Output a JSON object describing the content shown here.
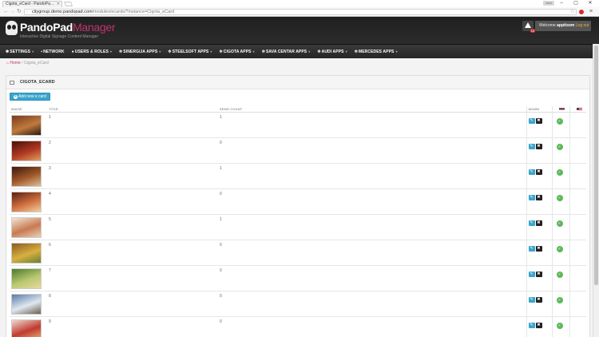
{
  "browser": {
    "tab_title": "Cigota_eCard - PandoPa…",
    "url_host": "citygroup.demo.pandopad.com",
    "url_path": "/modules/ecards/?instance=Cigota_eCard",
    "user_button": "User"
  },
  "header": {
    "brand_main": "PandoPad",
    "brand_accent": "Manager",
    "tagline": "Interactive Digital Signage Content Manager",
    "notification_count": "10",
    "welcome_prefix": "Welcome ",
    "username": "appitsom",
    "logout": " Log out"
  },
  "nav": [
    {
      "icon": "gear-icon",
      "label": "SETTINGS",
      "dropdown": true
    },
    {
      "icon": "network-icon",
      "label": "NETWORK",
      "dropdown": false
    },
    {
      "icon": "users-icon",
      "label": "USERS & ROLES",
      "dropdown": true
    },
    {
      "icon": "cogs-icon",
      "label": "SINERGIJA APPS",
      "dropdown": true
    },
    {
      "icon": "cogs-icon",
      "label": "STEELSOFT APPS",
      "dropdown": true
    },
    {
      "icon": "cogs-icon",
      "label": "CIGOTA APPS",
      "dropdown": true
    },
    {
      "icon": "cogs-icon",
      "label": "SAVA CENTAR APPS",
      "dropdown": true
    },
    {
      "icon": "cogs-icon",
      "label": "AUDI APPS",
      "dropdown": true
    },
    {
      "icon": "cogs-icon",
      "label": "MERCEDES APPS",
      "dropdown": true
    }
  ],
  "breadcrumb": {
    "home": "Home",
    "current": "Cigota_eCard"
  },
  "panel": {
    "title": "CIGOTA_ECARD",
    "add_button": "Add new e card"
  },
  "table": {
    "headers": {
      "image": "IMAGE",
      "title": "TITLE",
      "send_count": "SEND COUNT",
      "admin": "ADMIN"
    },
    "rows": [
      {
        "title": "1",
        "send_count": "1",
        "thumb": [
          "#7a3a1c",
          "#c07a3e",
          "#2c1a10"
        ]
      },
      {
        "title": "2",
        "send_count": "0",
        "thumb": [
          "#4a0f0a",
          "#b03a22",
          "#e0a060"
        ]
      },
      {
        "title": "3",
        "send_count": "1",
        "thumb": [
          "#3a1810",
          "#a35a2a",
          "#d9c09a"
        ]
      },
      {
        "title": "4",
        "send_count": "0",
        "thumb": [
          "#5a2010",
          "#d07040",
          "#f0d0a0"
        ]
      },
      {
        "title": "5",
        "send_count": "1",
        "thumb": [
          "#f3e6d8",
          "#c87a50",
          "#e8d0b8"
        ]
      },
      {
        "title": "6",
        "send_count": "0",
        "thumb": [
          "#8a5a20",
          "#d8b040",
          "#6a8030"
        ]
      },
      {
        "title": "7",
        "send_count": "0",
        "thumb": [
          "#4a7a2a",
          "#b8c870",
          "#e8d8a0"
        ]
      },
      {
        "title": "8",
        "send_count": "0",
        "thumb": [
          "#5a7aa8",
          "#dfe8f0",
          "#6a6050"
        ]
      },
      {
        "title": "9",
        "send_count": "0",
        "thumb": [
          "#f0d8d0",
          "#c03a30",
          "#e8b070"
        ]
      }
    ]
  }
}
